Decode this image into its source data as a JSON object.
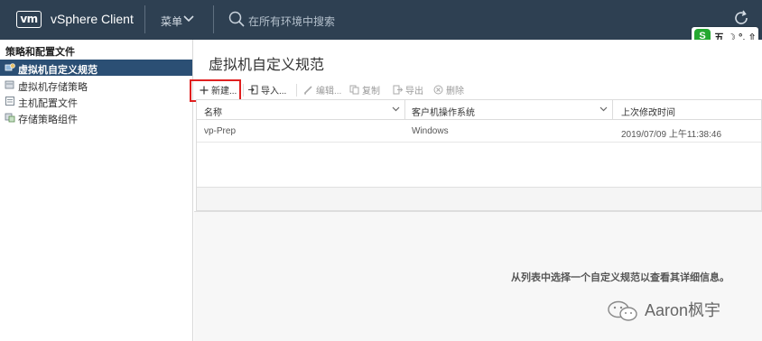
{
  "header": {
    "logo_text": "vm",
    "app_title": "vSphere Client",
    "menu_label": "菜单",
    "search_placeholder": "在所有环境中搜索"
  },
  "ime": {
    "logo": "S",
    "text": "五 ☽ °, ⇧"
  },
  "sidebar": {
    "header": "策略和配置文件",
    "items": [
      {
        "label": "虚拟机自定义规范",
        "icon": "vm-spec-icon",
        "active": true
      },
      {
        "label": "虚拟机存储策略",
        "icon": "storage-policy-icon",
        "active": false
      },
      {
        "label": "主机配置文件",
        "icon": "host-profile-icon",
        "active": false
      },
      {
        "label": "存储策略组件",
        "icon": "storage-component-icon",
        "active": false
      }
    ]
  },
  "main": {
    "title": "虚拟机自定义规范",
    "toolbar": {
      "new": "新建...",
      "import": "导入...",
      "edit": "编辑...",
      "copy": "复制",
      "export": "导出",
      "delete": "删除"
    },
    "table": {
      "columns": [
        "名称",
        "客户机操作系统",
        "上次修改时间"
      ],
      "rows": [
        {
          "name": "vp-Prep",
          "os": "Windows",
          "modified": "2019/07/09 上午11:38:46"
        }
      ]
    },
    "detail_message": "从列表中选择一个自定义规范以查看其详细信息。"
  },
  "watermark": "Aaron枫宇",
  "colors": {
    "topbar": "#2e4052",
    "active_item": "#2b4f74",
    "highlight": "#e02020"
  }
}
